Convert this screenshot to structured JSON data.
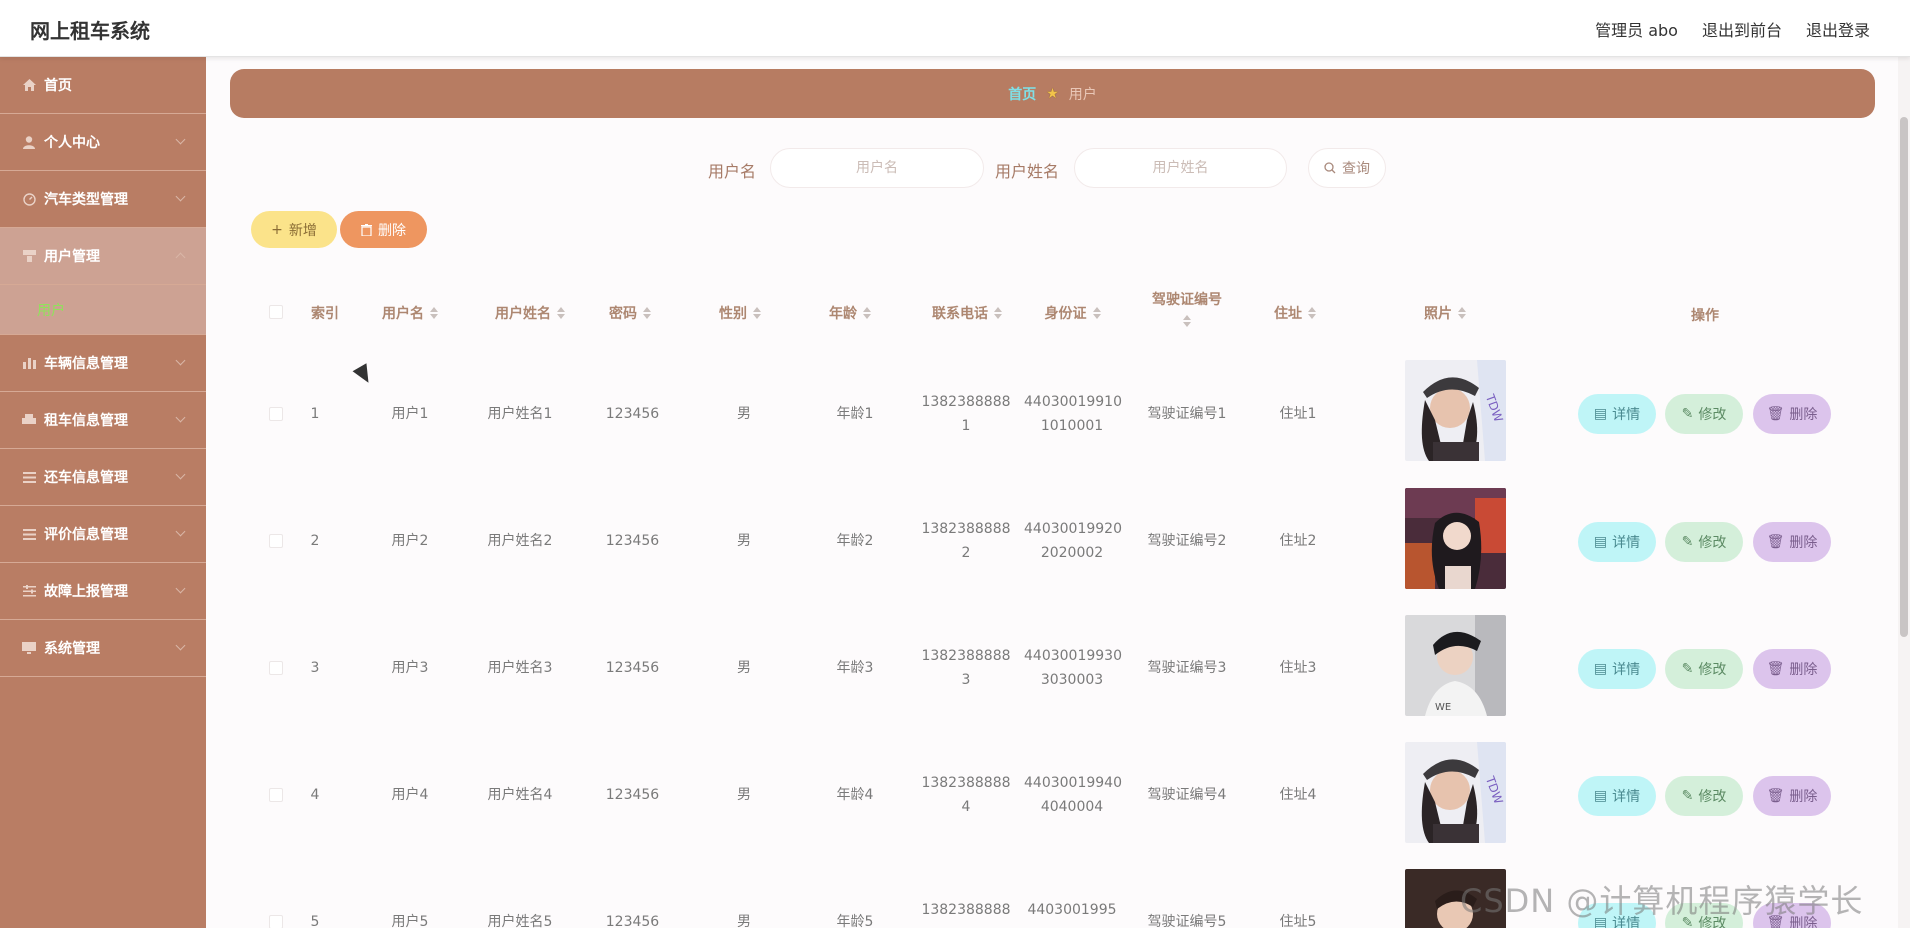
{
  "header": {
    "title": "网上租车系统",
    "user": "管理员 abo",
    "front": "退出到前台",
    "logout": "退出登录"
  },
  "sidebar": {
    "items": [
      {
        "label": "首页",
        "icon": "home-icon"
      },
      {
        "label": "个人中心",
        "icon": "person-icon"
      },
      {
        "label": "汽车类型管理",
        "icon": "dashboard-icon"
      },
      {
        "label": "用户管理",
        "icon": "user-manage-icon"
      },
      {
        "label": "车辆信息管理",
        "icon": "bar-chart-icon"
      },
      {
        "label": "租车信息管理",
        "icon": "car-icon"
      },
      {
        "label": "还车信息管理",
        "icon": "list-icon"
      },
      {
        "label": "评价信息管理",
        "icon": "list-icon"
      },
      {
        "label": "故障上报管理",
        "icon": "sliders-icon"
      },
      {
        "label": "系统管理",
        "icon": "monitor-icon"
      }
    ],
    "sub": "用户"
  },
  "breadcrumb": {
    "home": "首页",
    "current": "用户"
  },
  "search": {
    "username_label": "用户名",
    "username_placeholder": "用户名",
    "name_label": "用户姓名",
    "name_placeholder": "用户姓名",
    "button": "查询"
  },
  "actions": {
    "add": "新增",
    "delete": "删除"
  },
  "table": {
    "headers": [
      "索引",
      "用户名",
      "用户姓名",
      "密码",
      "性别",
      "年龄",
      "联系电话",
      "身份证",
      "驾驶证编号",
      "住址",
      "照片",
      "操作"
    ],
    "rows": [
      {
        "idx": "1",
        "username": "用户1",
        "name": "用户姓名1",
        "pwd": "123456",
        "sex": "男",
        "age": "年龄1",
        "phone1": "1382388888",
        "phone2": "1",
        "id1": "44030019910",
        "id2": "1010001",
        "license": "驾驶证编号1",
        "addr": "住址1"
      },
      {
        "idx": "2",
        "username": "用户2",
        "name": "用户姓名2",
        "pwd": "123456",
        "sex": "男",
        "age": "年龄2",
        "phone1": "1382388888",
        "phone2": "2",
        "id1": "44030019920",
        "id2": "2020002",
        "license": "驾驶证编号2",
        "addr": "住址2"
      },
      {
        "idx": "3",
        "username": "用户3",
        "name": "用户姓名3",
        "pwd": "123456",
        "sex": "男",
        "age": "年龄3",
        "phone1": "1382388888",
        "phone2": "3",
        "id1": "44030019930",
        "id2": "3030003",
        "license": "驾驶证编号3",
        "addr": "住址3"
      },
      {
        "idx": "4",
        "username": "用户4",
        "name": "用户姓名4",
        "pwd": "123456",
        "sex": "男",
        "age": "年龄4",
        "phone1": "1382388888",
        "phone2": "4",
        "id1": "44030019940",
        "id2": "4040004",
        "license": "驾驶证编号4",
        "addr": "住址4"
      },
      {
        "idx": "5",
        "username": "用户5",
        "name": "用户姓名5",
        "pwd": "123456",
        "sex": "男",
        "age": "年龄5",
        "phone1": "1382388888",
        "phone2": "",
        "id1": "4403001995",
        "id2": "",
        "license": "驾驶证编号5",
        "addr": "住址5"
      }
    ],
    "ops": {
      "detail": "详情",
      "edit": "修改",
      "remove": "删除"
    }
  },
  "watermark": "CSDN @计算机程序猿学长"
}
